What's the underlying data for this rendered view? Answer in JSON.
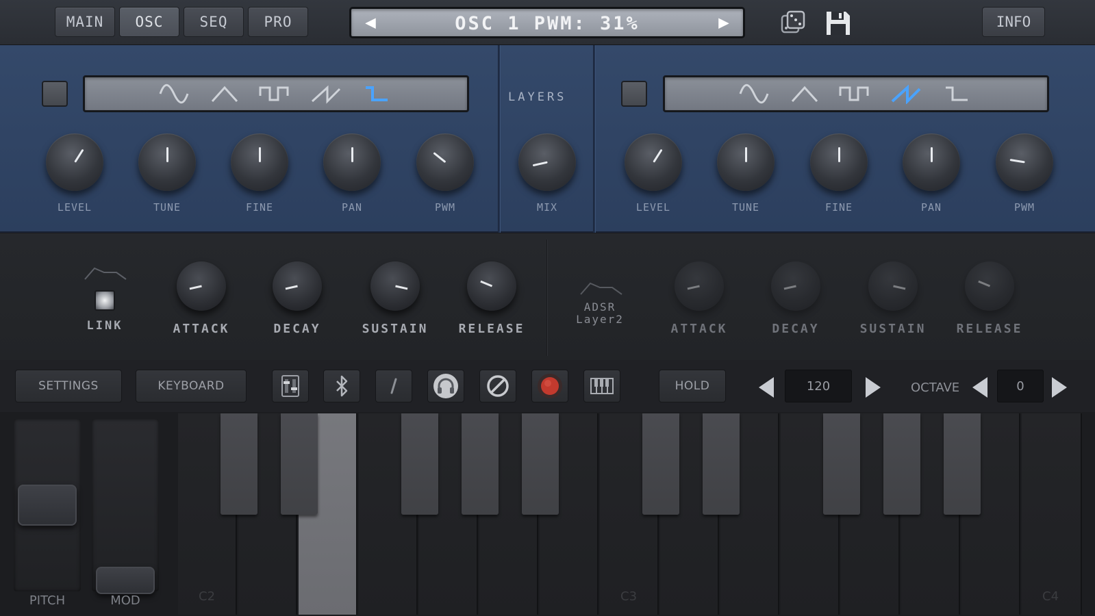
{
  "header": {
    "tabs": [
      {
        "label": "MAIN",
        "active": false
      },
      {
        "label": "OSC",
        "active": true
      },
      {
        "label": "SEQ",
        "active": false
      },
      {
        "label": "PRO",
        "active": false
      }
    ],
    "display_text": "OSC 1 PWM: 31%",
    "info_label": "INFO",
    "icons": [
      "dice-icon",
      "save-icon"
    ]
  },
  "osc1": {
    "knobs": [
      {
        "label": "LEVEL",
        "value": 0.62
      },
      {
        "label": "TUNE",
        "value": 0.5
      },
      {
        "label": "FINE",
        "value": 0.5
      },
      {
        "label": "PAN",
        "value": 0.5
      },
      {
        "label": "PWM",
        "value": 0.31
      }
    ],
    "waves": [
      "sine",
      "triangle",
      "square",
      "saw",
      "pulse"
    ],
    "selected_wave": "pulse"
  },
  "layers": {
    "label": "LAYERS",
    "knob": {
      "label": "MIX",
      "value": 0.12
    }
  },
  "osc2": {
    "knobs": [
      {
        "label": "LEVEL",
        "value": 0.62
      },
      {
        "label": "TUNE",
        "value": 0.5
      },
      {
        "label": "FINE",
        "value": 0.5
      },
      {
        "label": "PAN",
        "value": 0.5
      },
      {
        "label": "PWM",
        "value": 0.2
      }
    ],
    "waves": [
      "sine",
      "triangle",
      "square",
      "saw",
      "pulse"
    ],
    "selected_wave": "saw"
  },
  "env1": {
    "link_label": "LINK",
    "knobs": [
      {
        "label": "ATTACK",
        "value": 0.12
      },
      {
        "label": "DECAY",
        "value": 0.12
      },
      {
        "label": "SUSTAIN",
        "value": 0.88
      },
      {
        "label": "RELEASE",
        "value": 0.25
      }
    ]
  },
  "env2": {
    "label_line1": "ADSR",
    "label_line2": "Layer2",
    "knobs": [
      {
        "label": "ATTACK",
        "value": 0.12
      },
      {
        "label": "DECAY",
        "value": 0.12
      },
      {
        "label": "SUSTAIN",
        "value": 0.88
      },
      {
        "label": "RELEASE",
        "value": 0.25
      }
    ]
  },
  "controls": {
    "settings_label": "SETTINGS",
    "keyboard_label": "KEYBOARD",
    "icon_buttons": [
      "mixer-icon",
      "bluetooth-icon",
      "slash-icon",
      "headphones-icon",
      "disable-icon",
      "record-icon",
      "piano-icon"
    ],
    "hold_label": "HOLD",
    "tempo": "120",
    "octave_label": "OCTAVE",
    "octave_value": "0"
  },
  "wheels": {
    "pitch_label": "PITCH",
    "mod_label": "MOD"
  },
  "keyboard": {
    "note_labels": [
      "C2",
      "C3",
      "C4"
    ],
    "pressed_key": "E2"
  },
  "colors": {
    "osc_panel": "#34496a",
    "active_wave": "#4aa3ff",
    "record": "#c23a2e"
  }
}
